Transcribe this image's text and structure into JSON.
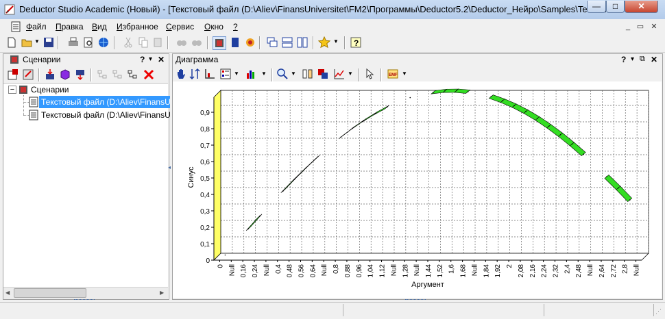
{
  "window": {
    "title": "Deductor Studio Academic (Новый) - [Текстовый файл (D:\\Aliev\\FinansUniversitet\\FM2\\Программы\\Deductor5.2\\Deductor_Нейро\\Samples\\TestForPPP....",
    "min_glyph": "—",
    "max_glyph": "□",
    "close_glyph": "✕"
  },
  "menu": {
    "items": [
      {
        "accel": "Ф",
        "rest": "айл"
      },
      {
        "accel": "П",
        "rest": "равка"
      },
      {
        "accel": "В",
        "rest": "ид"
      },
      {
        "accel": "И",
        "rest": "збранное"
      },
      {
        "accel": "С",
        "rest": "ервис"
      },
      {
        "accel": "О",
        "rest": "кно"
      },
      {
        "accel": "?",
        "rest": ""
      }
    ],
    "mdi_min": "_",
    "mdi_restore": "▭",
    "mdi_close": "✕"
  },
  "left_panel": {
    "title": "Сценарии",
    "help": "?",
    "pin": "▾",
    "close": "✕",
    "tree": {
      "root": "Сценарии",
      "expander": "⊟",
      "items": [
        {
          "label": "Текстовый файл (D:\\Aliev\\FinansUni",
          "selected": true
        },
        {
          "label": "Текстовый файл (D:\\Aliev\\FinansUni",
          "selected": false
        }
      ]
    }
  },
  "right_panel": {
    "title": "Диаграмма",
    "help": "?",
    "pin": "▾",
    "float": "⧉",
    "close": "✕"
  },
  "colors": {
    "accent": "#3399ff",
    "band": "#33dd22",
    "wall": "#ffff66"
  },
  "chart_data": {
    "type": "area",
    "xlabel": "Аргумент",
    "ylabel": "Синус",
    "ylim": [
      0,
      1
    ],
    "yticks": [
      "0",
      "0,1",
      "0,2",
      "0,3",
      "0,4",
      "0,5",
      "0,6",
      "0,7",
      "0,8",
      "0,9"
    ],
    "categories": [
      "0",
      "Null",
      "0,16",
      "0,24",
      "Null",
      "0,4",
      "0,48",
      "0,56",
      "0,64",
      "Null",
      "0,8",
      "0,88",
      "0,96",
      "1,04",
      "1,12",
      "Null",
      "1,28",
      "Null",
      "1,44",
      "1,52",
      "1,6",
      "1,68",
      "Null",
      "1,84",
      "1,92",
      "2",
      "2,08",
      "2,16",
      "2,24",
      "2,32",
      "2,4",
      "2,48",
      "Null",
      "2,64",
      "2,72",
      "2,8",
      "Null"
    ],
    "grid": true,
    "series": [
      {
        "x": [
          0,
          0.08,
          0.16,
          0.24,
          0.32,
          0.4,
          0.48,
          0.56,
          0.64,
          0.72,
          0.8,
          0.88,
          0.96,
          1.04,
          1.12,
          1.2,
          1.28,
          1.36,
          1.44,
          1.52,
          1.6,
          1.68,
          1.76,
          1.84,
          1.92,
          2,
          2.08,
          2.16,
          2.24,
          2.32,
          2.4,
          2.48,
          2.56,
          2.64,
          2.72,
          2.8,
          2.88
        ],
        "values": [
          0,
          null,
          0.159,
          0.238,
          null,
          0.389,
          0.462,
          0.531,
          0.597,
          null,
          0.717,
          0.771,
          0.819,
          0.862,
          0.9,
          null,
          0.958,
          null,
          0.991,
          0.999,
          1,
          0.994,
          null,
          0.964,
          0.939,
          0.909,
          0.873,
          0.831,
          0.784,
          0.732,
          0.675,
          0.614,
          null,
          0.477,
          0.408,
          0.335,
          null
        ]
      }
    ]
  }
}
